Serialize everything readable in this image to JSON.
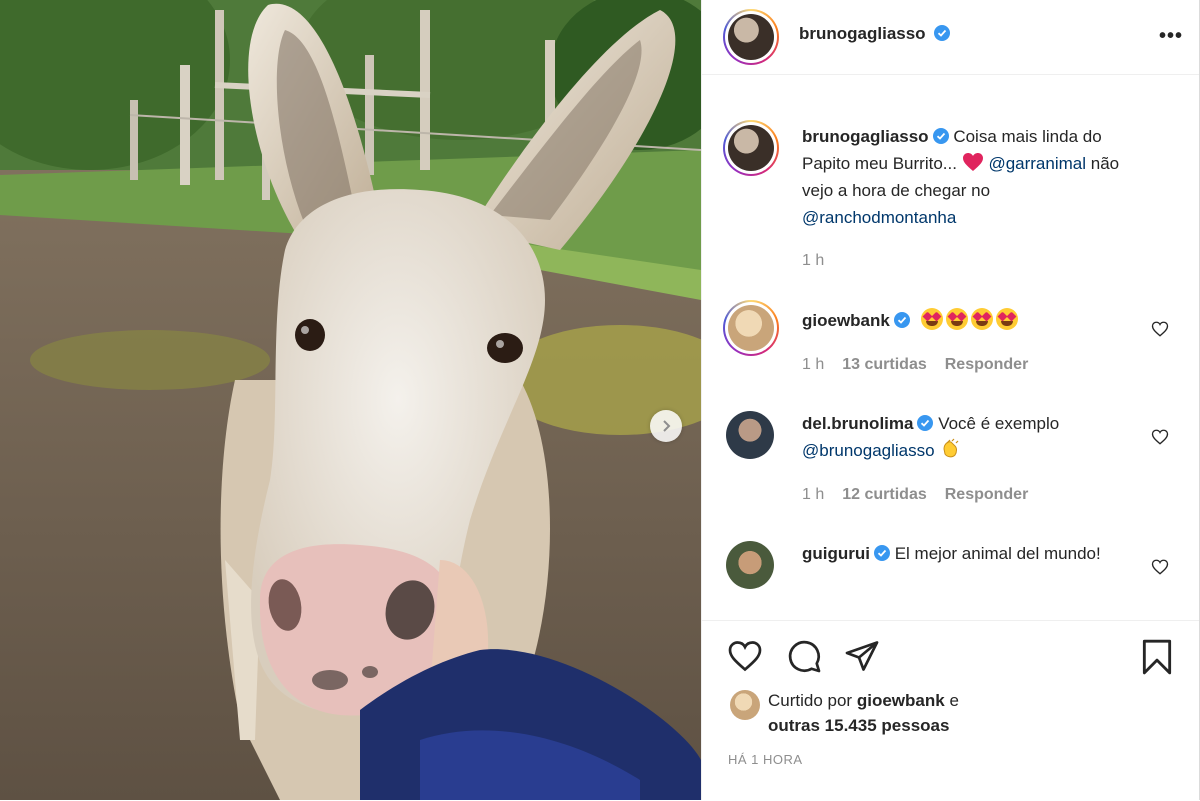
{
  "post": {
    "author": "brunogagliasso",
    "more_label": "•••",
    "caption": {
      "username": "brunogagliasso",
      "text_1": "Coisa mais linda do Papito meu Burrito...",
      "mention_1": "@garranimal",
      "text_2": "não vejo a hora de chegar no",
      "mention_2": "@ranchodmontanha",
      "time": "1 h"
    },
    "comments": [
      {
        "username": "gioewbank",
        "emoji_count": 4,
        "time": "1 h",
        "likes": "13 curtidas",
        "reply": "Responder"
      },
      {
        "username": "del.brunolima",
        "text": "Você é exemplo",
        "mention": "@brunogagliasso",
        "time": "1 h",
        "likes": "12 curtidas",
        "reply": "Responder"
      },
      {
        "username": "guigurui",
        "text": "El mejor animal del mundo!"
      }
    ],
    "liked_by": {
      "prefix": "Curtido por",
      "user": "gioewbank",
      "conj": "e",
      "others": "outras 15.435 pessoas"
    },
    "timestamp": "HÁ 1 HORA"
  },
  "colors": {
    "verified": "#3897f0",
    "heart": "#e0245e",
    "mention": "#00376b",
    "muted": "#8e8e8e"
  },
  "icons": [
    "verified-badge-icon",
    "heart-icon",
    "comment-icon",
    "share-icon",
    "bookmark-icon",
    "more-icon",
    "chevron-right-icon"
  ]
}
